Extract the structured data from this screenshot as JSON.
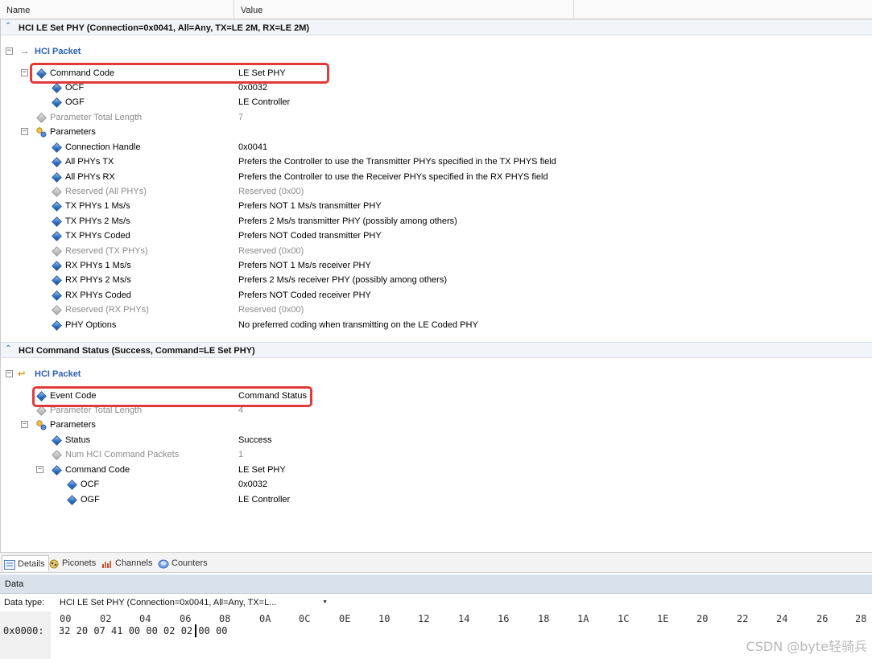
{
  "columns": {
    "name": "Name",
    "value": "Value"
  },
  "section1": {
    "title": "HCI LE Set PHY (Connection=0x0041, All=Any, TX=LE 2M, RX=LE 2M)",
    "packet": "HCI Packet",
    "rows": [
      {
        "name": "Command Code",
        "value": "LE Set PHY"
      },
      {
        "name": "OCF",
        "value": "0x0032"
      },
      {
        "name": "OGF",
        "value": "LE Controller"
      },
      {
        "name": "Parameter Total Length",
        "value": "7"
      },
      {
        "name": "Parameters",
        "value": ""
      },
      {
        "name": "Connection Handle",
        "value": "0x0041"
      },
      {
        "name": "All PHYs TX",
        "value": "Prefers the Controller to use the Transmitter PHYs specified in the TX PHYS field"
      },
      {
        "name": "All PHYs RX",
        "value": "Prefers the Controller to use the Receiver PHYs specified in the RX PHYS field"
      },
      {
        "name": "Reserved (All PHYs)",
        "value": "Reserved (0x00)"
      },
      {
        "name": "TX PHYs 1 Ms/s",
        "value": "Prefers NOT 1 Ms/s transmitter PHY"
      },
      {
        "name": "TX PHYs 2 Ms/s",
        "value": "Prefers 2 Ms/s transmitter PHY (possibly among others)"
      },
      {
        "name": "TX PHYs Coded",
        "value": "Prefers NOT Coded transmitter PHY"
      },
      {
        "name": "Reserved (TX PHYs)",
        "value": "Reserved (0x00)"
      },
      {
        "name": "RX PHYs 1 Ms/s",
        "value": "Prefers NOT 1 Ms/s receiver PHY"
      },
      {
        "name": "RX PHYs 2 Ms/s",
        "value": "Prefers 2 Ms/s receiver PHY (possibly among others)"
      },
      {
        "name": "RX PHYs Coded",
        "value": "Prefers NOT Coded receiver PHY"
      },
      {
        "name": "Reserved (RX PHYs)",
        "value": "Reserved (0x00)"
      },
      {
        "name": "PHY Options",
        "value": "No preferred coding when transmitting on the LE Coded PHY"
      }
    ]
  },
  "section2": {
    "title": "HCI Command Status (Success, Command=LE Set PHY)",
    "packet": "HCI Packet",
    "rows": [
      {
        "name": "Event Code",
        "value": "Command Status"
      },
      {
        "name": "Parameter Total Length",
        "value": "4"
      },
      {
        "name": "Parameters",
        "value": ""
      },
      {
        "name": "Status",
        "value": "Success"
      },
      {
        "name": "Num HCI Command Packets",
        "value": "1"
      },
      {
        "name": "Command Code",
        "value": "LE Set PHY"
      },
      {
        "name": "OCF",
        "value": "0x0032"
      },
      {
        "name": "OGF",
        "value": "LE Controller"
      }
    ]
  },
  "tabs": [
    "Details",
    "Piconets",
    "Channels",
    "Counters"
  ],
  "data_panel": {
    "title": "Data",
    "type_label": "Data type:",
    "type_value": "HCI LE Set PHY (Connection=0x0041, All=Any, TX=L...",
    "columns": [
      "00",
      "02",
      "04",
      "06",
      "08",
      "0A",
      "0C",
      "0E",
      "10",
      "12",
      "14",
      "16",
      "18",
      "1A",
      "1C",
      "1E",
      "20",
      "22",
      "24",
      "26",
      "28"
    ],
    "address": "0x0000:",
    "bytes": "32 20 07 41 00 00 02 02 00 00"
  },
  "watermark": "CSDN @byte轻骑兵",
  "colors": {
    "packet_blue": "#2b5fb5",
    "highlight_red": "#e03a3a",
    "data_header": "#d9e2ec"
  }
}
